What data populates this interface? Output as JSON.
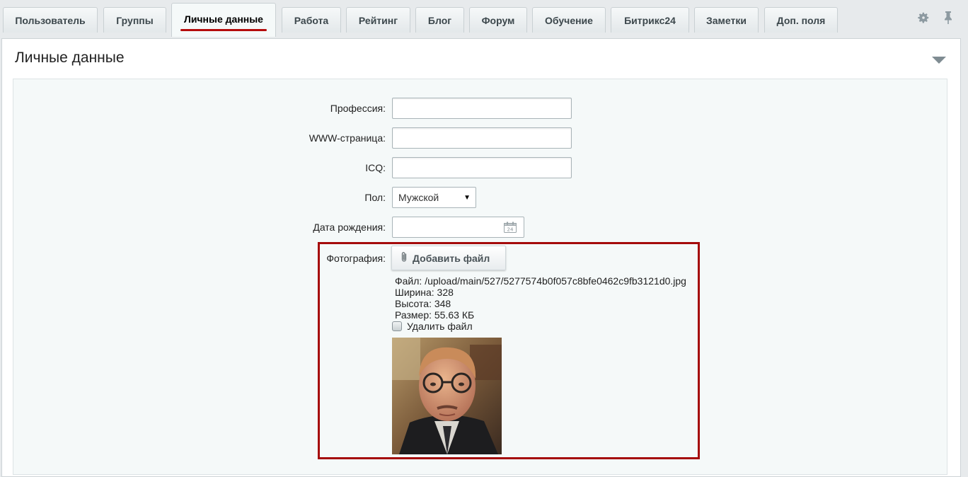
{
  "tabs": [
    {
      "label": "Пользователь"
    },
    {
      "label": "Группы"
    },
    {
      "label": "Личные данные",
      "active": true
    },
    {
      "label": "Работа"
    },
    {
      "label": "Рейтинг"
    },
    {
      "label": "Блог"
    },
    {
      "label": "Форум"
    },
    {
      "label": "Обучение"
    },
    {
      "label": "Битрикс24"
    },
    {
      "label": "Заметки"
    },
    {
      "label": "Доп. поля"
    }
  ],
  "toolbar": {
    "settings_icon": "gear-icon",
    "pin_icon": "pin-icon"
  },
  "panel": {
    "title": "Личные данные"
  },
  "form": {
    "profession": {
      "label": "Профессия:",
      "value": ""
    },
    "www": {
      "label": "WWW-страница:",
      "value": ""
    },
    "icq": {
      "label": "ICQ:",
      "value": ""
    },
    "gender": {
      "label": "Пол:",
      "value": "Мужской"
    },
    "birthday": {
      "label": "Дата рождения:",
      "value": "",
      "calendar_day": "24"
    },
    "photo": {
      "label": "Фотография:",
      "add_button": "Добавить файл",
      "file_line": "Файл: /upload/main/527/5277574b0f057c8bfe0462c9fb3121d0.jpg",
      "width_line": "Ширина: 328",
      "height_line": "Высота: 348",
      "size_line": "Размер: 55.63 КБ",
      "delete_label": "Удалить файл"
    }
  },
  "colors": {
    "accent": "#b50c0c",
    "highlight_border": "#a50b0b",
    "form_bg": "#f5f9f9"
  }
}
